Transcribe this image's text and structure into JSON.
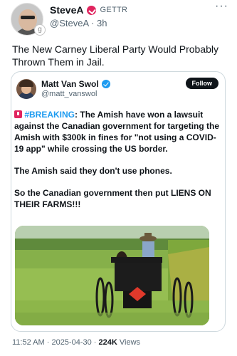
{
  "author": {
    "display_name": "SteveA",
    "source": "GETTR",
    "handle": "@SteveA",
    "time": "3h"
  },
  "more_label": "···",
  "post_text": "The New Carney Liberal Party Would Probably Thrown Them in Jail.",
  "quoted": {
    "display_name": "Matt Van Swol",
    "handle": "@matt_vanswol",
    "follow_label": "Follow",
    "hashtag": "#BREAKING",
    "para1_rest": ": The Amish have won a lawsuit against the Canadian government for targeting the Amish with $300k in fines for \"not using a COVID-19 app\" while crossing the US border.",
    "para2": "The Amish said they don't use phones.",
    "para3": "So the Canadian government then put LIENS ON THEIR FARMS!!!"
  },
  "meta": {
    "time": "11:52 AM",
    "sep1": " · ",
    "date": "2025-04-30",
    "sep2": " · ",
    "views_count": "224K",
    "views_label": " Views"
  }
}
